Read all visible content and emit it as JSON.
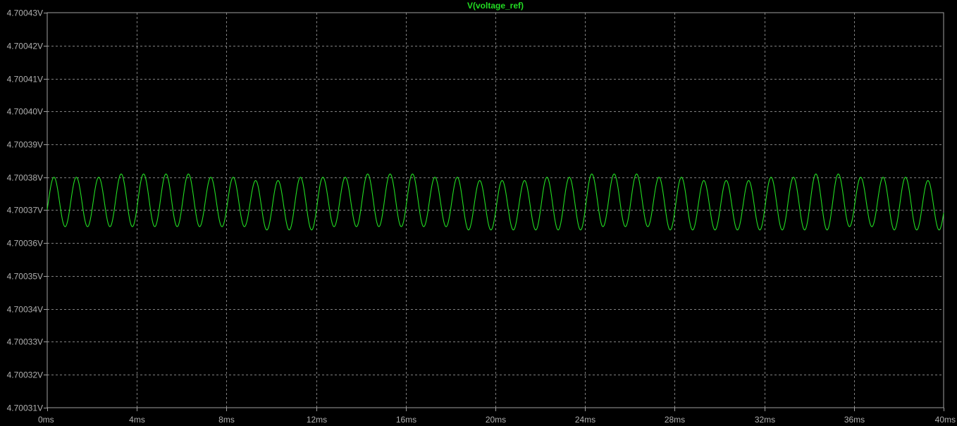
{
  "colors": {
    "background": "#000000",
    "frame": "#a0a0a0",
    "grid": "#808080",
    "trace": "#22dd22",
    "tick_text": "#b0b0b0"
  },
  "chart_data": {
    "type": "line",
    "title": "V(voltage_ref)",
    "xlabel": "",
    "ylabel": "",
    "grid": true,
    "legend": "none",
    "xlim": [
      0,
      40
    ],
    "ylim": [
      4.70031,
      4.70043
    ],
    "x_ticks": [
      0,
      4,
      8,
      12,
      16,
      20,
      24,
      28,
      32,
      36,
      40
    ],
    "x_tick_labels": [
      "0ms",
      "4ms",
      "8ms",
      "12ms",
      "16ms",
      "20ms",
      "24ms",
      "28ms",
      "32ms",
      "36ms",
      "40ms"
    ],
    "y_ticks": [
      4.70043,
      4.70042,
      4.70041,
      4.7004,
      4.70039,
      4.70038,
      4.70037,
      4.70036,
      4.70035,
      4.70034,
      4.70033,
      4.70032,
      4.70031
    ],
    "y_tick_labels": [
      "4.70043V",
      "4.70042V",
      "4.70041V",
      "4.70040V",
      "4.70039V",
      "4.70038V",
      "4.70037V",
      "4.70036V",
      "4.70035V",
      "4.70034V",
      "4.70033V",
      "4.70032V",
      "4.70031V"
    ],
    "series": [
      {
        "name": "V(voltage_ref)",
        "color": "#22dd22",
        "peaks_ms": [
          0.3,
          1.3,
          2.3,
          3.3,
          4.3,
          5.3,
          6.3,
          7.3,
          8.3,
          9.3,
          10.3,
          11.3,
          12.3,
          13.3,
          14.3,
          15.3,
          16.3,
          17.3,
          18.3,
          19.3,
          20.3,
          21.3,
          22.3,
          23.3,
          24.3,
          25.3,
          26.3,
          27.3,
          28.3,
          29.3,
          30.3,
          31.3,
          32.3,
          33.3,
          34.3,
          35.3,
          36.3,
          37.3,
          38.3,
          39.3
        ],
        "peak_values_V": [
          4.70038,
          4.70038,
          4.70038,
          4.700381,
          4.700381,
          4.700381,
          4.700381,
          4.70038,
          4.70038,
          4.700379,
          4.700379,
          4.70038,
          4.70038,
          4.70038,
          4.700381,
          4.700381,
          4.700381,
          4.70038,
          4.70038,
          4.700379,
          4.700379,
          4.700379,
          4.70038,
          4.70038,
          4.700381,
          4.700381,
          4.700381,
          4.70038,
          4.70038,
          4.700379,
          4.700379,
          4.700379,
          4.70038,
          4.70038,
          4.700381,
          4.700381,
          4.70038,
          4.70038,
          4.70038,
          4.700379
        ],
        "trough_values_V": [
          4.700365,
          4.700365,
          4.700365,
          4.700365,
          4.700365,
          4.700365,
          4.700365,
          4.700365,
          4.700365,
          4.700364,
          4.700364,
          4.700364,
          4.700365,
          4.700365,
          4.700365,
          4.700365,
          4.700365,
          4.700365,
          4.700364,
          4.700364,
          4.700364,
          4.700364,
          4.700364,
          4.700364,
          4.700365,
          4.700365,
          4.700365,
          4.700364,
          4.700364,
          4.700364,
          4.700364,
          4.700364,
          4.700364,
          4.700364,
          4.700364,
          4.700365,
          4.700365,
          4.700364,
          4.700364,
          4.700364
        ],
        "start_value_V": 4.700372,
        "end_value_V": 4.70037
      }
    ]
  }
}
